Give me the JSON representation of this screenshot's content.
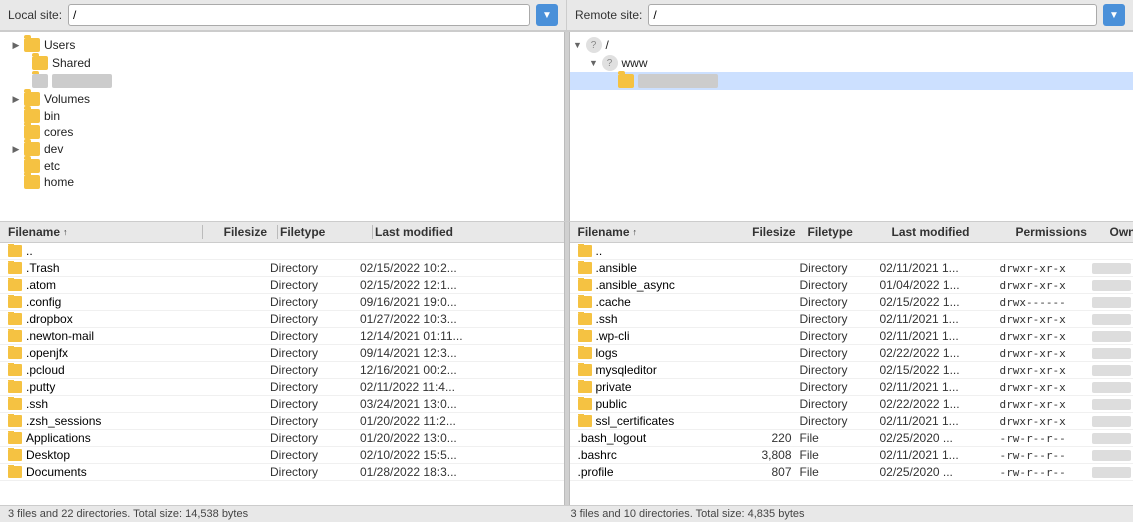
{
  "local": {
    "label": "Local site:",
    "path": "/",
    "tree": [
      {
        "indent": 1,
        "toggle": "▶",
        "type": "folder",
        "label": "Users",
        "depth": 1
      },
      {
        "indent": 2,
        "toggle": "",
        "type": "folder",
        "label": "Shared",
        "depth": 2
      },
      {
        "indent": 2,
        "toggle": "",
        "type": "folder",
        "label": "",
        "depth": 2
      },
      {
        "indent": 1,
        "toggle": "▶",
        "type": "folder",
        "label": "Volumes",
        "depth": 1
      },
      {
        "indent": 1,
        "toggle": "",
        "type": "folder",
        "label": "bin",
        "depth": 1
      },
      {
        "indent": 1,
        "toggle": "",
        "type": "folder",
        "label": "cores",
        "depth": 1
      },
      {
        "indent": 1,
        "toggle": "▶",
        "type": "folder",
        "label": "dev",
        "depth": 1
      },
      {
        "indent": 1,
        "toggle": "",
        "type": "folder",
        "label": "etc",
        "depth": 1
      },
      {
        "indent": 1,
        "toggle": "",
        "type": "folder",
        "label": "home",
        "depth": 1
      }
    ],
    "header": {
      "filename": "Filename",
      "filesize": "Filesize",
      "filetype": "Filetype",
      "lastmod": "Last modified"
    },
    "files": [
      {
        "name": "..",
        "size": "",
        "type": "",
        "modified": ""
      },
      {
        "name": ".Trash",
        "size": "",
        "type": "Directory",
        "modified": "02/15/2022 10:2..."
      },
      {
        "name": ".atom",
        "size": "",
        "type": "Directory",
        "modified": "02/15/2022 12:1..."
      },
      {
        "name": ".config",
        "size": "",
        "type": "Directory",
        "modified": "09/16/2021 19:0..."
      },
      {
        "name": ".dropbox",
        "size": "",
        "type": "Directory",
        "modified": "01/27/2022 10:3..."
      },
      {
        "name": ".newton-mail",
        "size": "",
        "type": "Directory",
        "modified": "12/14/2021 01:11..."
      },
      {
        "name": ".openjfx",
        "size": "",
        "type": "Directory",
        "modified": "09/14/2021 12:3..."
      },
      {
        "name": ".pcloud",
        "size": "",
        "type": "Directory",
        "modified": "12/16/2021 00:2..."
      },
      {
        "name": ".putty",
        "size": "",
        "type": "Directory",
        "modified": "02/11/2022 11:4..."
      },
      {
        "name": ".ssh",
        "size": "",
        "type": "Directory",
        "modified": "03/24/2021 13:0..."
      },
      {
        "name": ".zsh_sessions",
        "size": "",
        "type": "Directory",
        "modified": "01/20/2022 11:2..."
      },
      {
        "name": "Applications",
        "size": "",
        "type": "Directory",
        "modified": "01/20/2022 13:0..."
      },
      {
        "name": "Desktop",
        "size": "",
        "type": "Directory",
        "modified": "02/10/2022 15:5..."
      },
      {
        "name": "Documents",
        "size": "",
        "type": "Directory",
        "modified": "01/28/2022 18:3..."
      }
    ],
    "status": "3 files and 22 directories. Total size: 14,538 bytes"
  },
  "remote": {
    "label": "Remote site:",
    "path": "/",
    "tree": [
      {
        "level": 0,
        "type": "question",
        "label": "/"
      },
      {
        "level": 1,
        "type": "question",
        "label": "www"
      },
      {
        "level": 2,
        "type": "folder",
        "label": ""
      }
    ],
    "header": {
      "filename": "Filename",
      "filesize": "Filesize",
      "filetype": "Filetype",
      "lastmod": "Last modified",
      "permissions": "Permissions",
      "owner": "Owner/Group"
    },
    "files": [
      {
        "name": "..",
        "size": "",
        "type": "",
        "modified": "",
        "permissions": "",
        "owner": ""
      },
      {
        "name": ".ansible",
        "size": "",
        "type": "Directory",
        "modified": "02/11/2021 1...",
        "permissions": "drwxr-xr-x",
        "owner": ""
      },
      {
        "name": ".ansible_async",
        "size": "",
        "type": "Directory",
        "modified": "01/04/2022 1...",
        "permissions": "drwxr-xr-x",
        "owner": ""
      },
      {
        "name": ".cache",
        "size": "",
        "type": "Directory",
        "modified": "02/15/2022 1...",
        "permissions": "drwx------",
        "owner": ""
      },
      {
        "name": ".ssh",
        "size": "",
        "type": "Directory",
        "modified": "02/11/2021 1...",
        "permissions": "drwxr-xr-x",
        "owner": ""
      },
      {
        "name": ".wp-cli",
        "size": "",
        "type": "Directory",
        "modified": "02/11/2021 1...",
        "permissions": "drwxr-xr-x",
        "owner": ""
      },
      {
        "name": "logs",
        "size": "",
        "type": "Directory",
        "modified": "02/22/2022 1...",
        "permissions": "drwxr-xr-x",
        "owner": ""
      },
      {
        "name": "mysqleditor",
        "size": "",
        "type": "Directory",
        "modified": "02/15/2022 1...",
        "permissions": "drwxr-xr-x",
        "owner": ""
      },
      {
        "name": "private",
        "size": "",
        "type": "Directory",
        "modified": "02/11/2021 1...",
        "permissions": "drwxr-xr-x",
        "owner": ""
      },
      {
        "name": "public",
        "size": "",
        "type": "Directory",
        "modified": "02/22/2022 1...",
        "permissions": "drwxr-xr-x",
        "owner": ""
      },
      {
        "name": "ssl_certificates",
        "size": "",
        "type": "Directory",
        "modified": "02/11/2021 1...",
        "permissions": "drwxr-xr-x",
        "owner": ""
      },
      {
        "name": ".bash_logout",
        "size": "220",
        "type": "File",
        "modified": "02/25/2020 ...",
        "permissions": "-rw-r--r--",
        "owner": ""
      },
      {
        "name": ".bashrc",
        "size": "3,808",
        "type": "File",
        "modified": "02/11/2021 1...",
        "permissions": "-rw-r--r--",
        "owner": ""
      },
      {
        "name": ".profile",
        "size": "807",
        "type": "File",
        "modified": "02/25/2020 ...",
        "permissions": "-rw-r--r--",
        "owner": ""
      }
    ],
    "status": "3 files and 10 directories. Total size: 4,835 bytes"
  }
}
